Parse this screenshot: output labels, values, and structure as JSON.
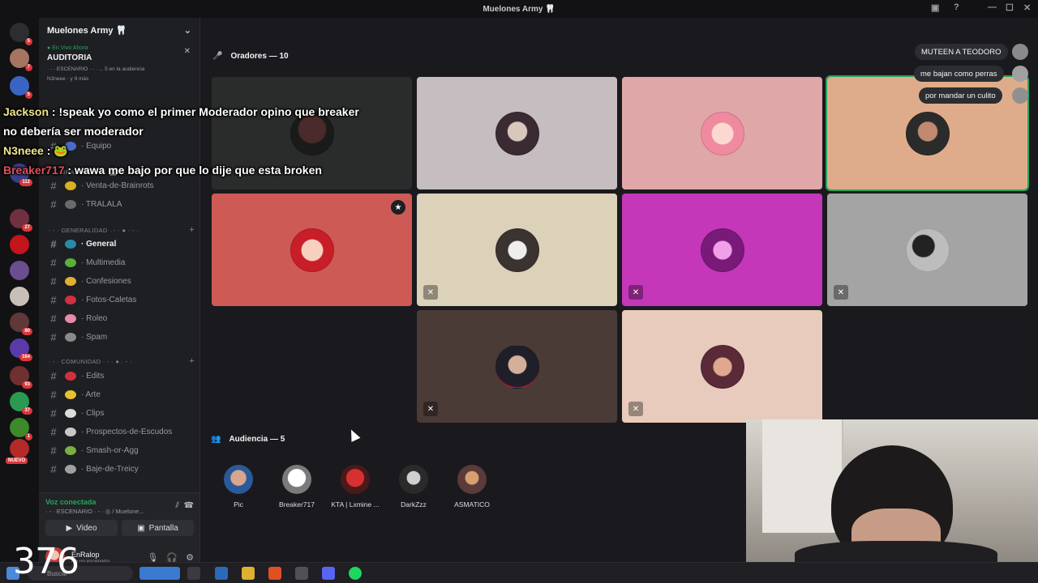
{
  "window": {
    "title": "Muelones Army 🦷"
  },
  "guild_badges": [
    "5",
    "7",
    "5",
    "112",
    "27",
    "80",
    "164",
    "93",
    "37",
    "1"
  ],
  "guild_new_label": "NUEVO",
  "sidebar": {
    "server_name": "Muelones Army 🦷",
    "stage": {
      "live_label": "En Vivo Ahora",
      "title": "AUDITORIA",
      "meta": "· - · ESCENARIO · - · ... 5 en la audiencia",
      "audience": "N3neee · y 9 más"
    },
    "channels_top": [
      {
        "label": "· Equipo"
      }
    ],
    "category_brainrot": "· - · BRAINROT · - · 📈 · - ·",
    "channels_brainrot": [
      {
        "label": "· Venta-de-Brainrots"
      },
      {
        "label": "· TRALALA"
      }
    ],
    "category_general": "· - · GENERALIDAD · - · ● · - ·",
    "channels_general": [
      {
        "label": "· General"
      },
      {
        "label": "· Multimedia"
      },
      {
        "label": "· Confesiones"
      },
      {
        "label": "· Fotos-Caletas"
      },
      {
        "label": "· Roleo"
      },
      {
        "label": "· Spam"
      }
    ],
    "category_comunidad": "· - · COMUNIDAD · - · ● · - ·",
    "channels_comunidad": [
      {
        "label": "· Edits"
      },
      {
        "label": "· Arte"
      },
      {
        "label": "· Clips"
      },
      {
        "label": "· Prospectos-de-Escudos"
      },
      {
        "label": "· Smash-or-Agg"
      },
      {
        "label": "· Baje-de-Treicy"
      }
    ],
    "voice": {
      "status": "Voz conectada",
      "location": "· - · ESCENARIO · - · ◎ / Muelone...",
      "video_label": "Video",
      "screen_label": "Pantalla"
    },
    "user": {
      "name": "EnRalop",
      "sub": "En un escenario"
    }
  },
  "stage_view": {
    "speakers_title": "Oradores — 10",
    "audience_title": "Audiencia — 5",
    "audience": [
      {
        "name": "Pic"
      },
      {
        "name": "Breaker717"
      },
      {
        "name": "KTA | Lxmine ..."
      },
      {
        "name": "DarkZzz"
      },
      {
        "name": "ASMATICO"
      }
    ]
  },
  "toasts": [
    "MUTEEN A TEODORO",
    "me bajan como perras",
    "por mandar un culito"
  ],
  "chat_overlay": [
    {
      "name": "Jackson",
      "text": " : !speak yo como el primer Moderador opino que breaker no debería ser moderador"
    },
    {
      "name": "N3neee",
      "text": " : 🐸"
    },
    {
      "name": "Breaker717",
      "text": " : wawa me bajo por que lo dije que esta broken"
    }
  ],
  "counter": "376",
  "taskbar": {
    "search_label": "Buscar"
  }
}
